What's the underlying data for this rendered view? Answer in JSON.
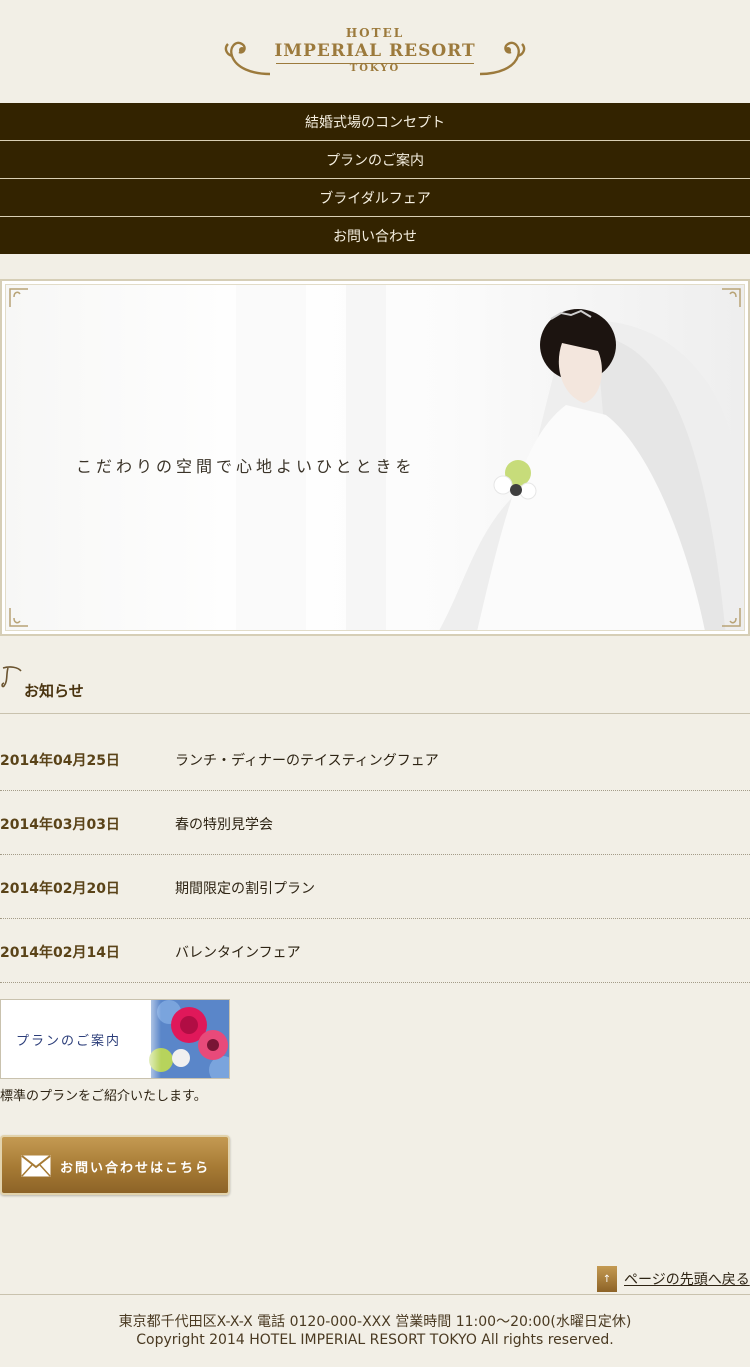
{
  "brand": {
    "hotel": "HOTEL",
    "name": "IMPERIAL RESORT",
    "city": "TOKYO",
    "gold": "#9c7a3c",
    "nav_bg": "#332300"
  },
  "nav": {
    "items": [
      {
        "label": "結婚式場のコンセプト"
      },
      {
        "label": "プランのご案内"
      },
      {
        "label": "ブライダルフェア"
      },
      {
        "label": "お問い合わせ"
      }
    ]
  },
  "hero": {
    "caption": "こだわりの空間で心地よいひとときを"
  },
  "news": {
    "title": "お知らせ",
    "items": [
      {
        "date": "2014年04月25日",
        "text": "ランチ・ディナーのテイスティングフェア"
      },
      {
        "date": "2014年03月03日",
        "text": "春の特別見学会"
      },
      {
        "date": "2014年02月20日",
        "text": "期間限定の割引プラン"
      },
      {
        "date": "2014年02月14日",
        "text": "バレンタインフェア"
      }
    ]
  },
  "plan": {
    "banner_label": "プランのご案内",
    "description": "標準のプランをご紹介いたします。"
  },
  "contact": {
    "label": "お問い合わせはこちら"
  },
  "pagetop": {
    "label": "ページの先頭へ戻る"
  },
  "footer": {
    "address": "東京都千代田区X-X-X 電話 0120-000-XXX 営業時間 11:00～20:00(水曜日定休)",
    "copyright": "Copyright 2014 HOTEL IMPERIAL RESORT TOKYO All rights reserved."
  }
}
